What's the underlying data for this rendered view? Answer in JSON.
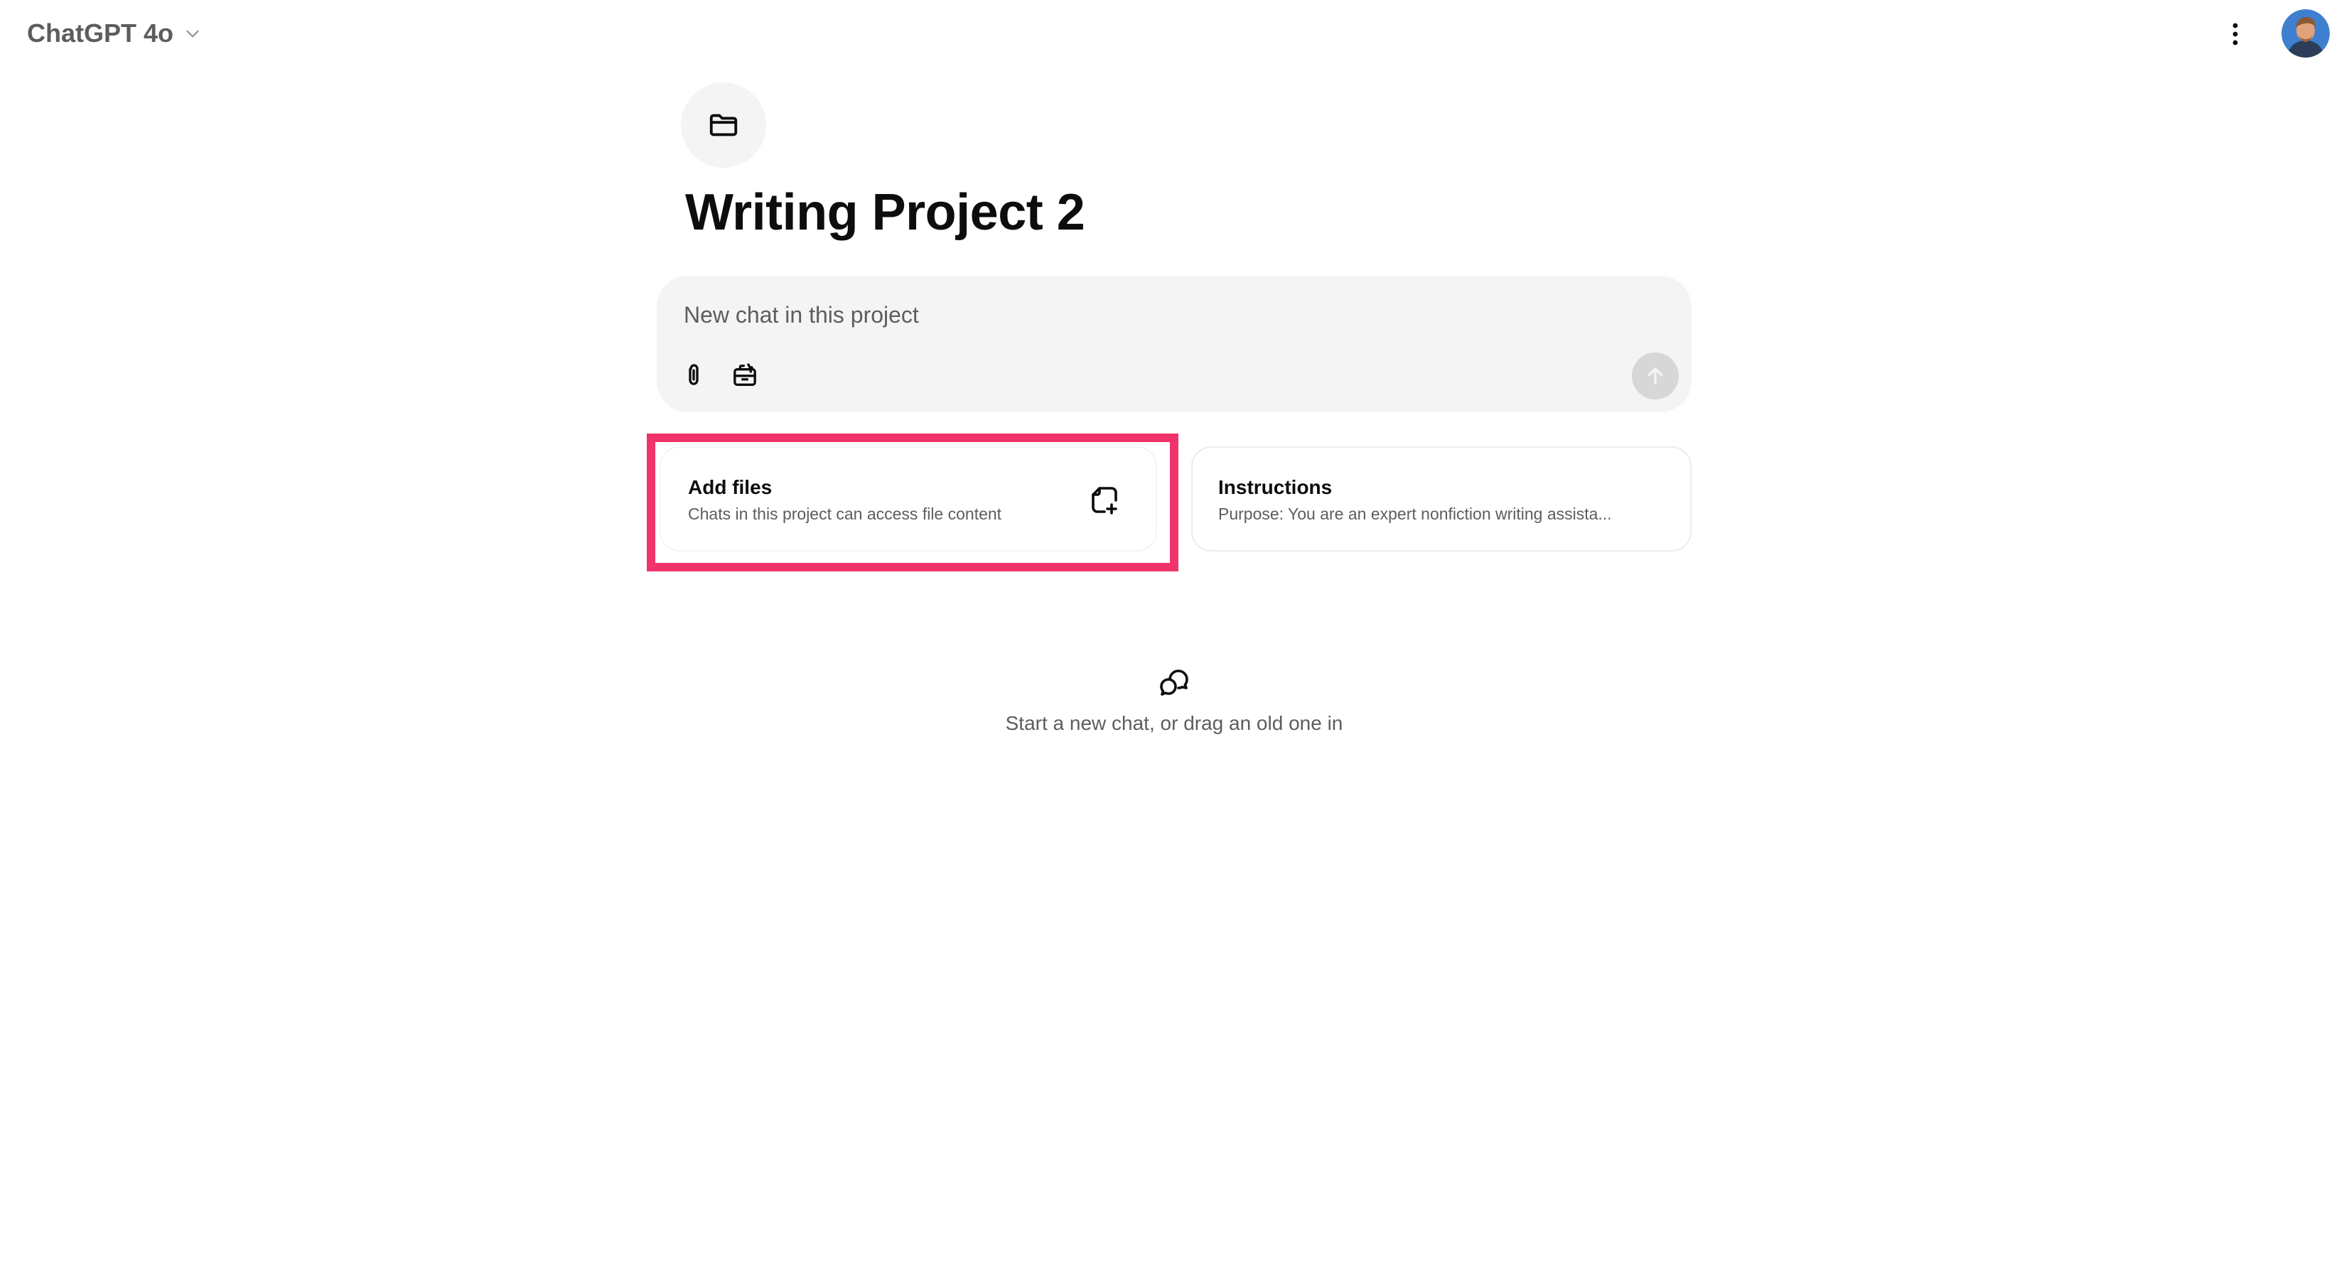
{
  "header": {
    "model_name": "ChatGPT 4o",
    "model_dropdown_icon": "chevron-down-icon",
    "more_icon": "kebab-menu-icon",
    "avatar_icon": "user-avatar"
  },
  "project": {
    "icon": "folder-icon",
    "title": "Writing Project 2"
  },
  "composer": {
    "placeholder": "New chat in this project",
    "attach_icon": "paperclip-icon",
    "tools_icon": "toolbox-icon",
    "send_icon": "arrow-up-icon"
  },
  "cards": {
    "files": {
      "title": "Add files",
      "subtitle": "Chats in this project can access file content",
      "icon": "add-file-icon"
    },
    "instructions": {
      "title": "Instructions",
      "subtitle": "Purpose: You are an expert nonfiction writing assista..."
    }
  },
  "empty_state": {
    "icon": "chat-bubbles-icon",
    "text": "Start a new chat, or drag an old one in"
  },
  "colors": {
    "highlight": "#f0336b",
    "composer_bg": "#f4f4f4",
    "muted_text": "#5d5d5d"
  }
}
